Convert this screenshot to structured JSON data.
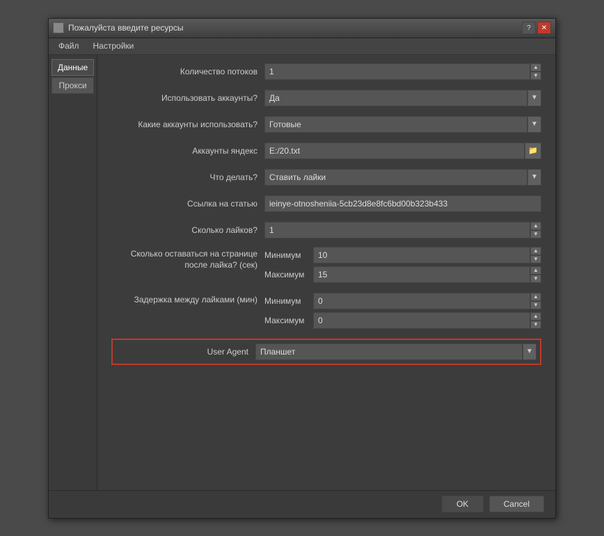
{
  "window": {
    "title": "Пожалуйста введите ресурсы",
    "icon": "app-icon"
  },
  "menu": {
    "items": [
      "Файл",
      "Настройки"
    ]
  },
  "sidebar": {
    "tabs": [
      {
        "label": "Данные",
        "active": true
      },
      {
        "label": "Прокси",
        "active": false
      }
    ]
  },
  "form": {
    "fields": [
      {
        "label": "Количество потоков",
        "type": "spinner",
        "value": "1"
      },
      {
        "label": "Использовать аккаунты?",
        "type": "dropdown",
        "value": "Да"
      },
      {
        "label": "Какие аккаунты использовать?",
        "type": "dropdown",
        "value": "Готовые"
      },
      {
        "label": "Аккаунты яндекс",
        "type": "file",
        "value": "E:/20.txt"
      },
      {
        "label": "Что делать?",
        "type": "dropdown",
        "value": "Ставить лайки"
      },
      {
        "label": "Ссылка на статью",
        "type": "text",
        "value": "ieinye-otnosheniia-5cb23d8e8fc6bd00b323b433"
      },
      {
        "label": "Сколько лайков?",
        "type": "spinner",
        "value": "1"
      }
    ],
    "time_section": {
      "label": "Сколько оставаться на странице\nпосле лайка? (сек)",
      "min_label": "Минимум",
      "max_label": "Максимум",
      "min_value": "10",
      "max_value": "15"
    },
    "delay_section": {
      "label": "Задержка между лайками (мин)",
      "min_label": "Минимум",
      "max_label": "Максимум",
      "min_value": "0",
      "max_value": "0"
    },
    "user_agent": {
      "label": "User Agent",
      "value": "Планшет"
    }
  },
  "buttons": {
    "ok": "OK",
    "cancel": "Cancel"
  }
}
